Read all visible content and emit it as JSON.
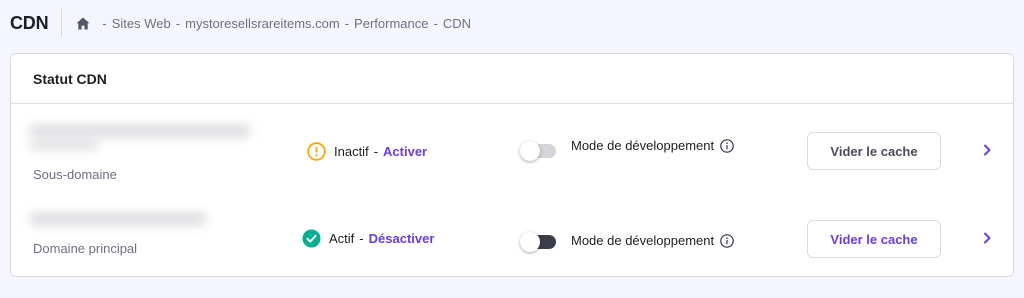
{
  "header": {
    "title": "CDN",
    "breadcrumb": [
      "Sites Web",
      "mystoresellsrareitems.com",
      "Performance",
      "CDN"
    ],
    "separator": "-"
  },
  "card": {
    "title": "Statut CDN",
    "rows": [
      {
        "domain_label": "Sous-domaine",
        "status_text": "Inactif",
        "status_action": "Activer",
        "status_icon": "warning-icon",
        "dev_mode_label": "Mode de développement",
        "dev_mode_enabled": false,
        "clear_cache_label": "Vider le cache"
      },
      {
        "domain_label": "Domaine principal",
        "status_text": "Actif",
        "status_action": "Désactiver",
        "status_icon": "check-circle-icon",
        "dev_mode_label": "Mode de développement",
        "dev_mode_enabled": false,
        "clear_cache_label": "Vider le cache"
      }
    ]
  },
  "colors": {
    "accent": "#673de6",
    "warning": "#ffa502",
    "success": "#00b090",
    "background": "#f4f5ff"
  }
}
